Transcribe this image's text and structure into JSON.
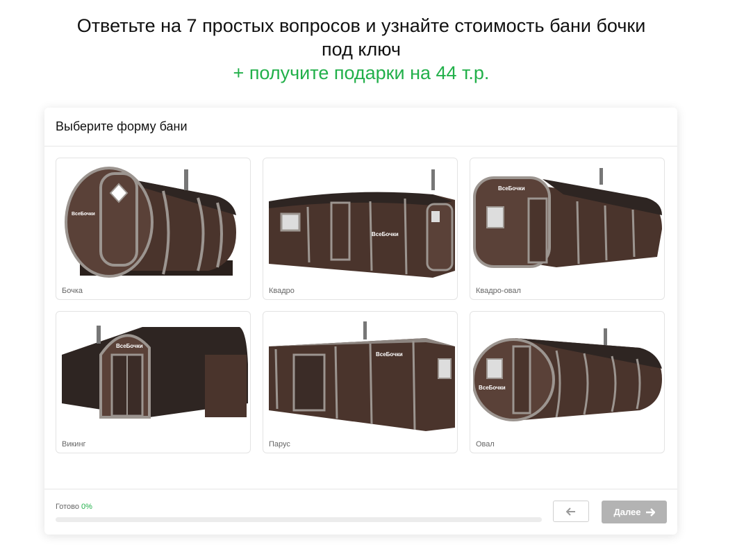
{
  "header": {
    "title_line1": "Ответьте на 7 простых вопросов и узнайте стоимость бани бочки",
    "title_line2": "под ключ",
    "promo": "+ получите подарки на 44 т.р."
  },
  "quiz": {
    "question": "Выберите форму бани",
    "options": [
      {
        "label": "Бочка",
        "icon": "barrel-sauna-image"
      },
      {
        "label": "Квадро",
        "icon": "quadro-sauna-image"
      },
      {
        "label": "Квадро-овал",
        "icon": "quadro-oval-sauna-image"
      },
      {
        "label": "Викинг",
        "icon": "viking-sauna-image"
      },
      {
        "label": "Парус",
        "icon": "parus-sauna-image"
      },
      {
        "label": "Овал",
        "icon": "oval-sauna-image"
      }
    ],
    "brand_on_images": "ВсеБочки",
    "progress": {
      "label": "Готово",
      "percent_text": "0%",
      "percent": 0
    },
    "back_icon": "arrow-left-icon",
    "next_label": "Далее",
    "next_icon": "arrow-right-icon"
  },
  "colors": {
    "accent": "#22b04a",
    "button_disabled": "#b3b3b3",
    "wood": "#4a342c",
    "roof": "#2e2522"
  }
}
